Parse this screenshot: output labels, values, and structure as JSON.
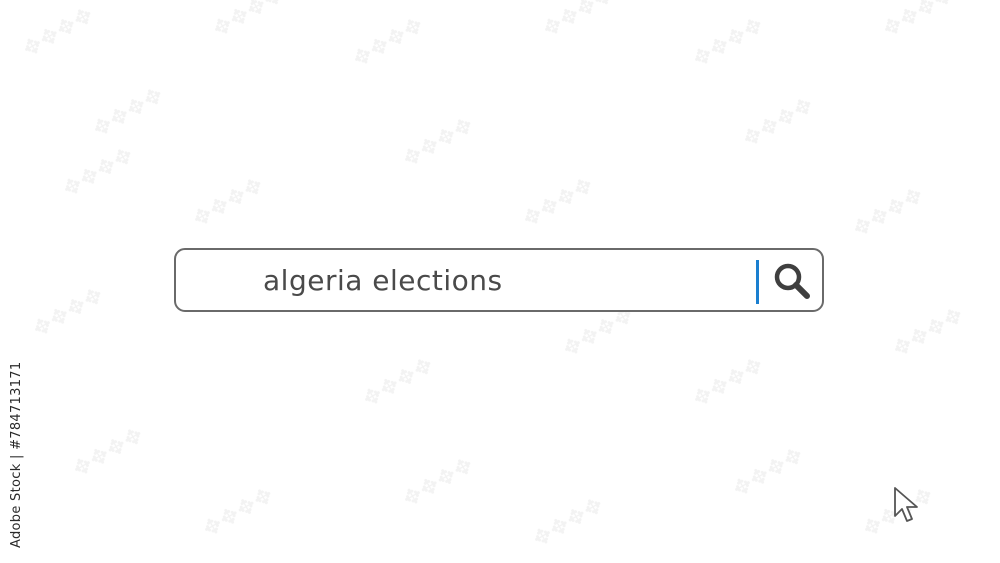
{
  "search": {
    "query": "algeria elections",
    "button_icon": "magnifier-icon"
  },
  "credit": {
    "text": "Adobe Stock | #784713171"
  },
  "cursor": {
    "icon": "arrow-pointer-icon"
  },
  "colors": {
    "caret": "#1a7fd0",
    "border": "#6a6a6a",
    "text": "#4a4a4a"
  }
}
